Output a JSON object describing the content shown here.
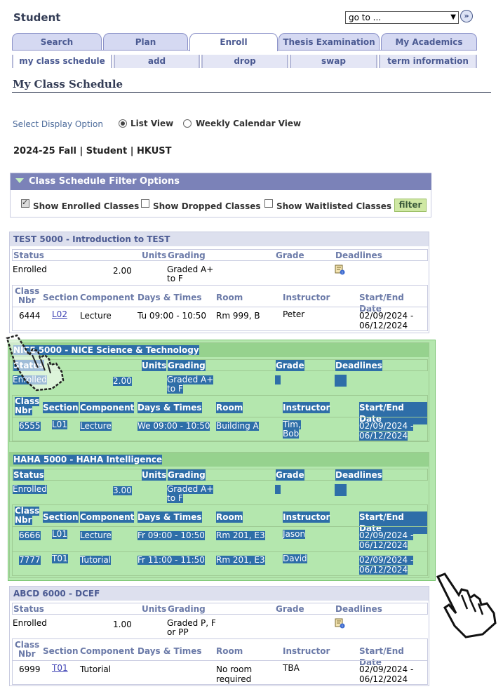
{
  "app_title": "Student",
  "goto": {
    "value": "go to ...",
    "button_icon": "double-chevron-right-icon"
  },
  "tabs": [
    {
      "label": "Search"
    },
    {
      "label": "Plan"
    },
    {
      "label": "Enroll",
      "active": true
    },
    {
      "label": "Thesis Examination"
    },
    {
      "label": "My Academics"
    }
  ],
  "subtabs": [
    {
      "label": "my class schedule"
    },
    {
      "label": "add"
    },
    {
      "label": "drop"
    },
    {
      "label": "swap"
    },
    {
      "label": "term information"
    }
  ],
  "page_title": "My Class Schedule",
  "display_option": {
    "label": "Select Display Option",
    "options": [
      {
        "label": "List View",
        "selected": true
      },
      {
        "label": "Weekly Calendar View",
        "selected": false
      }
    ]
  },
  "term": "2024-25 Fall | Student | HKUST",
  "filter": {
    "title": "Class Schedule Filter Options",
    "options": [
      {
        "label": "Show Enrolled Classes",
        "checked": true
      },
      {
        "label": "Show Dropped Classes",
        "checked": false
      },
      {
        "label": "Show Waitlisted Classes",
        "checked": false
      }
    ],
    "button": "filter"
  },
  "headers": {
    "status": "Status",
    "units": "Units",
    "grading": "Grading",
    "grade": "Grade",
    "deadlines": "Deadlines",
    "class_nbr_1": "Class",
    "class_nbr_2": "Nbr",
    "section": "Section",
    "component": "Component",
    "days_times": "Days & Times",
    "room": "Room",
    "instructor": "Instructor",
    "start_end": "Start/End Date"
  },
  "courses": [
    {
      "title": "TEST 5000 - Introduction to TEST",
      "status": "Enrolled",
      "units": "2.00",
      "grading_1": "Graded A+",
      "grading_2": "to F",
      "classes": [
        {
          "nbr": "6444",
          "section": "L02",
          "component": "Lecture",
          "days_times": "Tu 09:00 - 10:50",
          "room_1": "Rm 999, B",
          "room_2": "",
          "instr_1": "Peter",
          "instr_2": "",
          "date_1": "02/09/2024 -",
          "date_2": "06/12/2024"
        }
      ]
    },
    {
      "title": "NICE 5000 - NICE Science & Technology",
      "status": "Enrolled",
      "units": "2.00",
      "grading_1": "Graded A+",
      "grading_2": "to F",
      "classes": [
        {
          "nbr": "6555",
          "section": "L01",
          "component": "Lecture",
          "days_times": "We 09:00 - 10:50",
          "room_1": "Building A",
          "room_2": "",
          "instr_1": "Tim,",
          "instr_2": "Bob",
          "date_1": "02/09/2024 -",
          "date_2": "06/12/2024"
        }
      ]
    },
    {
      "title": "HAHA 5000 - HAHA Intelligence",
      "status": "Enrolled",
      "units": "3.00",
      "grading_1": "Graded A+",
      "grading_2": "to F",
      "classes": [
        {
          "nbr": "6666",
          "section": "L01",
          "component": "Lecture",
          "days_times": "Fr 09:00 - 10:50",
          "room_1": "Rm 201, E3",
          "room_2": "",
          "instr_1": "Jason",
          "instr_2": "",
          "date_1": "02/09/2024 -",
          "date_2": "06/12/2024"
        },
        {
          "nbr": "7777",
          "section": "T01",
          "component": "Tutorial",
          "days_times": "Fr 11:00 - 11:50",
          "room_1": "Rm 201, E3",
          "room_2": "",
          "instr_1": "David",
          "instr_2": "",
          "date_1": "02/09/2024 -",
          "date_2": "06/12/2024"
        }
      ]
    },
    {
      "title": "ABCD 6000 - DCEF",
      "status": "Enrolled",
      "units": "1.00",
      "grading_1": "Graded P, F",
      "grading_2": "or PP",
      "classes": [
        {
          "nbr": "6999",
          "section": "T01",
          "component": "Tutorial",
          "days_times": "",
          "room_1": "No room",
          "room_2": "required",
          "instr_1": "TBA",
          "instr_2": "",
          "date_1": "02/09/2024 -",
          "date_2": "06/12/2024"
        }
      ]
    }
  ],
  "colors": {
    "accent": "#7b82b8",
    "tab_bg": "#d5d9f2",
    "highlight": "#82d778",
    "selection": "#2e6ea8"
  }
}
